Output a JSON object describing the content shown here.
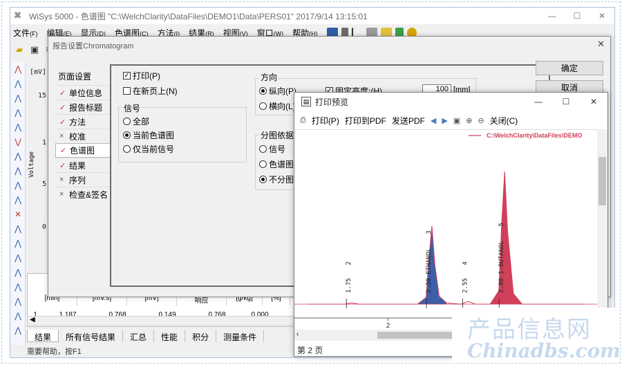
{
  "app": {
    "title": "WiSys 5000 - 色谱图 \"C:\\WelchClarity\\DataFiles\\DEMO1\\Data\\PERS01\" 2017/9/14 13:15:01",
    "menu": [
      {
        "label": "文件",
        "key": "(F)"
      },
      {
        "label": "编辑",
        "key": "(E)"
      },
      {
        "label": "显示",
        "key": "(D)"
      },
      {
        "label": "色谱图",
        "key": "(C)"
      },
      {
        "label": "方法",
        "key": "(I)"
      },
      {
        "label": "结果",
        "key": "(R)"
      },
      {
        "label": "视图",
        "key": "(V)"
      },
      {
        "label": "窗口",
        "key": "(W)"
      },
      {
        "label": "帮助",
        "key": "(H)"
      }
    ],
    "plot": {
      "unit": "[mV]",
      "yticks": [
        "15",
        "1",
        "5",
        "0"
      ],
      "yaxis_label": "Voltage"
    },
    "results_table": {
      "headers": [
        "[min]",
        "[mV.s]",
        "[mV]",
        "响应",
        "[g/kg]",
        "[%]"
      ],
      "row": [
        "1",
        "1.187",
        "0.768",
        "0.149",
        "0.768",
        "0.000"
      ]
    },
    "bottom_tabs": [
      "结果",
      "所有信号结果",
      "汇总",
      "性能",
      "积分",
      "测量条件"
    ],
    "status": "需要帮助，按F1"
  },
  "report_dialog": {
    "title": "报告设置Chromatogram",
    "page_list_header": "页面设置",
    "pages": [
      {
        "label": "单位信息",
        "mark": "✓",
        "state": "ok"
      },
      {
        "label": "报告标题",
        "mark": "✓",
        "state": "ok"
      },
      {
        "label": "方法",
        "mark": "✓",
        "state": "ok"
      },
      {
        "label": "校准",
        "mark": "×",
        "state": "x"
      },
      {
        "label": "色谱图",
        "mark": "✓",
        "state": "ok",
        "selected": true
      },
      {
        "label": "结果",
        "mark": "✓",
        "state": "ok"
      },
      {
        "label": "序列",
        "mark": "×",
        "state": "x"
      },
      {
        "label": "检查&签名",
        "mark": "×",
        "state": "x"
      }
    ],
    "print_checkbox": "打印(P)",
    "new_page_checkbox": "在新页上(N)",
    "signal_group": "信号",
    "signal_options": [
      "全部",
      "当前色谱图",
      "仅当前信号"
    ],
    "orientation_group": "方向",
    "portrait": "纵向(P)",
    "landscape": "横向(L)",
    "fixed_height": "固定高度:(H)",
    "fixed_height_value": "100",
    "fixed_height_unit": "[mm]",
    "split_group": "分图依据",
    "split_options": [
      "信号",
      "色谱图",
      "不分图"
    ],
    "ok_button": "确定",
    "cancel_button": "取消"
  },
  "preview": {
    "title": "打印预览",
    "toolbar": [
      "打印(P)",
      "打印到PDF",
      "发送PDF",
      "关闭(C)"
    ],
    "path_label": "C:\\WelchClarity\\DataFiles\\DEMO",
    "status": "第 2 页",
    "chart_data": {
      "type": "line",
      "title": "",
      "xlabel": "",
      "ylabel": "",
      "xlim": [
        1.45,
        3.35
      ],
      "x_ticks": [
        2,
        3
      ],
      "ylim": [
        0,
        1
      ],
      "series": [
        {
          "name": "C:\\WelchClarity\\DataFiles\\DEMO",
          "color": "#d1405a",
          "x": [
            1.45,
            1.7,
            1.75,
            1.8,
            2.2,
            2.26,
            2.28,
            2.3,
            2.32,
            2.35,
            2.4,
            2.5,
            2.55,
            2.6,
            2.7,
            2.76,
            2.78,
            2.8,
            2.82,
            2.86,
            2.92,
            3.35
          ],
          "y": [
            0.0,
            0.0,
            0.01,
            0.0,
            0.0,
            0.05,
            0.35,
            0.59,
            0.3,
            0.06,
            0.01,
            0.0,
            0.02,
            0.0,
            0.0,
            0.1,
            0.62,
            1.0,
            0.55,
            0.08,
            0.0,
            0.0
          ]
        }
      ],
      "peak_labels": [
        {
          "x": 1.75,
          "label": "1.75",
          "number": "2"
        },
        {
          "x": 2.3,
          "label": "2.30 ETHANOL",
          "number": "3"
        },
        {
          "x": 2.55,
          "label": "2.55",
          "number": "4"
        },
        {
          "x": 2.8,
          "label": "2.80 1-BUTANOL",
          "number": "5"
        }
      ],
      "fill_colors": {
        "ethanol": "#3d5fa8",
        "butanol": "#d1405a"
      }
    }
  },
  "watermark": {
    "line1": "产品信息网",
    "line2": "Chinadbs.com"
  }
}
